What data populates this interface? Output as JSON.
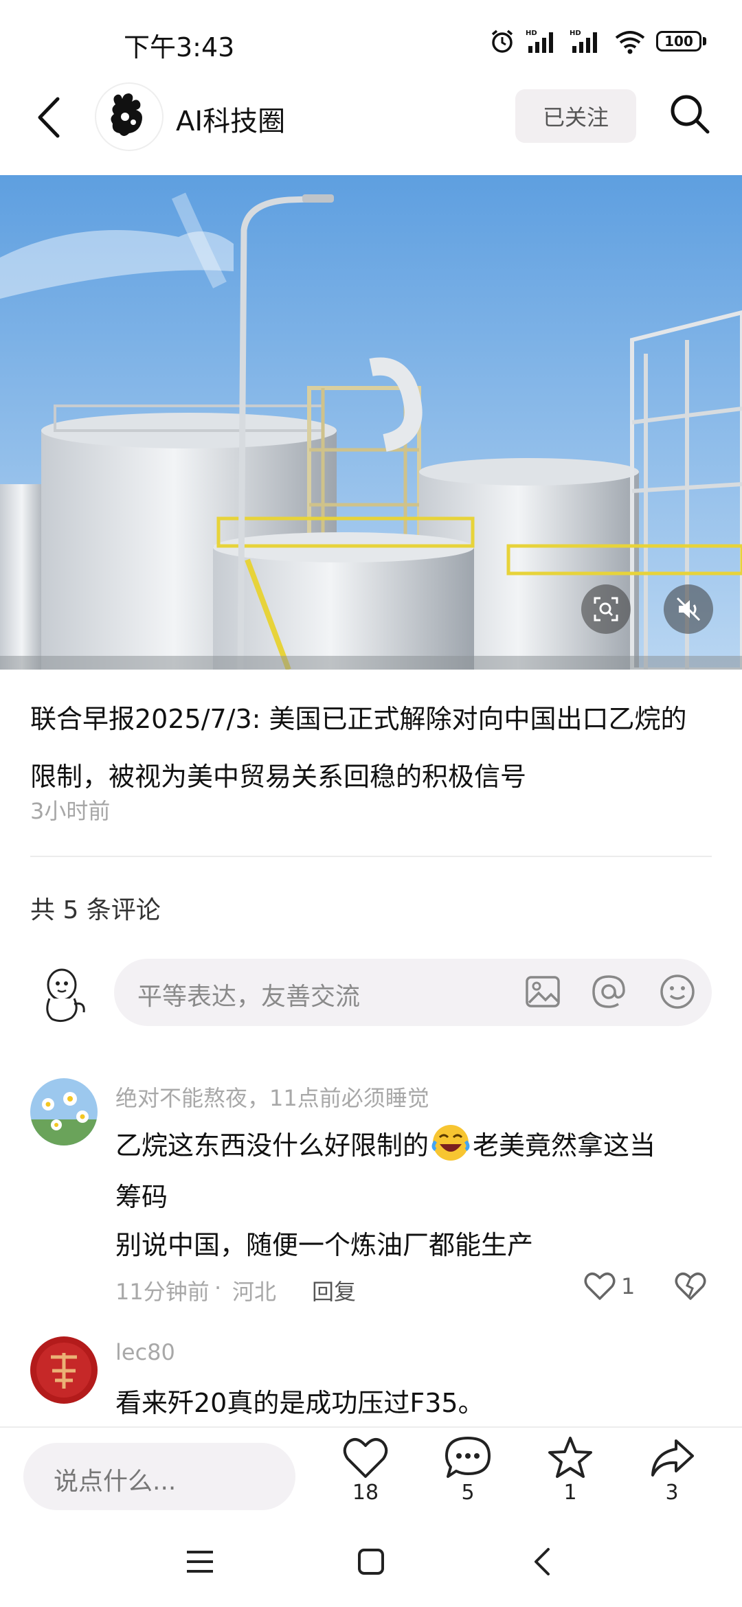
{
  "status_bar": {
    "time": "下午3:43",
    "battery": "100"
  },
  "header": {
    "channel_name": "AI科技圈",
    "follow_label": "已关注"
  },
  "article": {
    "headline": "联合早报2025/7/3: 美国已正式解除对向中国出口乙烷的限制，被视为美中贸易关系回稳的积极信号",
    "time": "3小时前"
  },
  "comments_section": {
    "count_label": "共 5 条评论",
    "input_placeholder": "平等表达，友善交流"
  },
  "comments": [
    {
      "user": "绝对不能熬夜，11点前必须睡觉",
      "text_line1a": "乙烷这东西没什么好限制的",
      "text_line1b": "老美竟然拿这当",
      "text_line2": "筹码",
      "text_line3": "别说中国，随便一个炼油厂都能生产",
      "time": "11分钟前",
      "separator": "·",
      "location": "河北",
      "reply": "回复",
      "likes": "1"
    },
    {
      "user": "lec80",
      "text": "看来歼20真的是成功压过F35。"
    }
  ],
  "bottom_bar": {
    "placeholder": "说点什么...",
    "like_count": "18",
    "comment_count": "5",
    "star_count": "1",
    "share_count": "3"
  }
}
